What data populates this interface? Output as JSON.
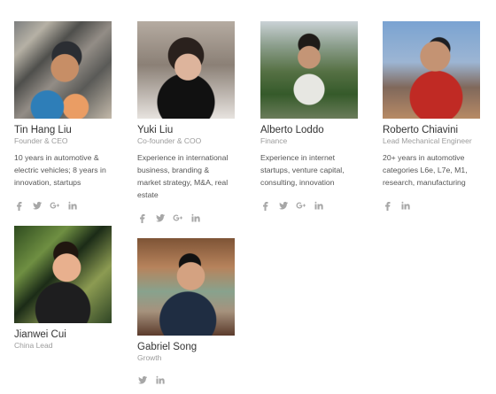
{
  "team": [
    {
      "name": "Tin Hang Liu",
      "role": "Founder & CEO",
      "bio": "10 years in automotive & electric vehicles; 8 years in innovation, startups",
      "socials": [
        "facebook-icon",
        "twitter-icon",
        "google-plus-icon",
        "linkedin-icon"
      ]
    },
    {
      "name": "Yuki Liu",
      "role": "Co-founder & COO",
      "bio": "Experience in international business, branding & market strategy, M&A, real estate",
      "socials": [
        "facebook-icon",
        "twitter-icon",
        "google-plus-icon",
        "linkedin-icon"
      ]
    },
    {
      "name": "Alberto Loddo",
      "role": "Finance",
      "bio": "Experience in internet startups, venture capital, consulting, innovation",
      "socials": [
        "facebook-icon",
        "twitter-icon",
        "google-plus-icon",
        "linkedin-icon"
      ]
    },
    {
      "name": "Roberto Chiavini",
      "role": "Lead Mechanical Engineer",
      "bio": "20+ years in automotive categories L6e, L7e, M1, research, manufacturing",
      "socials": [
        "facebook-icon",
        "linkedin-icon"
      ]
    },
    {
      "name": "Jianwei Cui",
      "role": "China Lead",
      "bio": "",
      "socials": []
    },
    {
      "name": "Gabriel Song",
      "role": "Growth",
      "bio": "",
      "socials": [
        "twitter-icon",
        "linkedin-icon"
      ]
    }
  ],
  "colors": {
    "name_text": "#333333",
    "role_text": "#9b9b9b",
    "bio_text": "#555555",
    "social_icon": "#a7a7a7"
  }
}
